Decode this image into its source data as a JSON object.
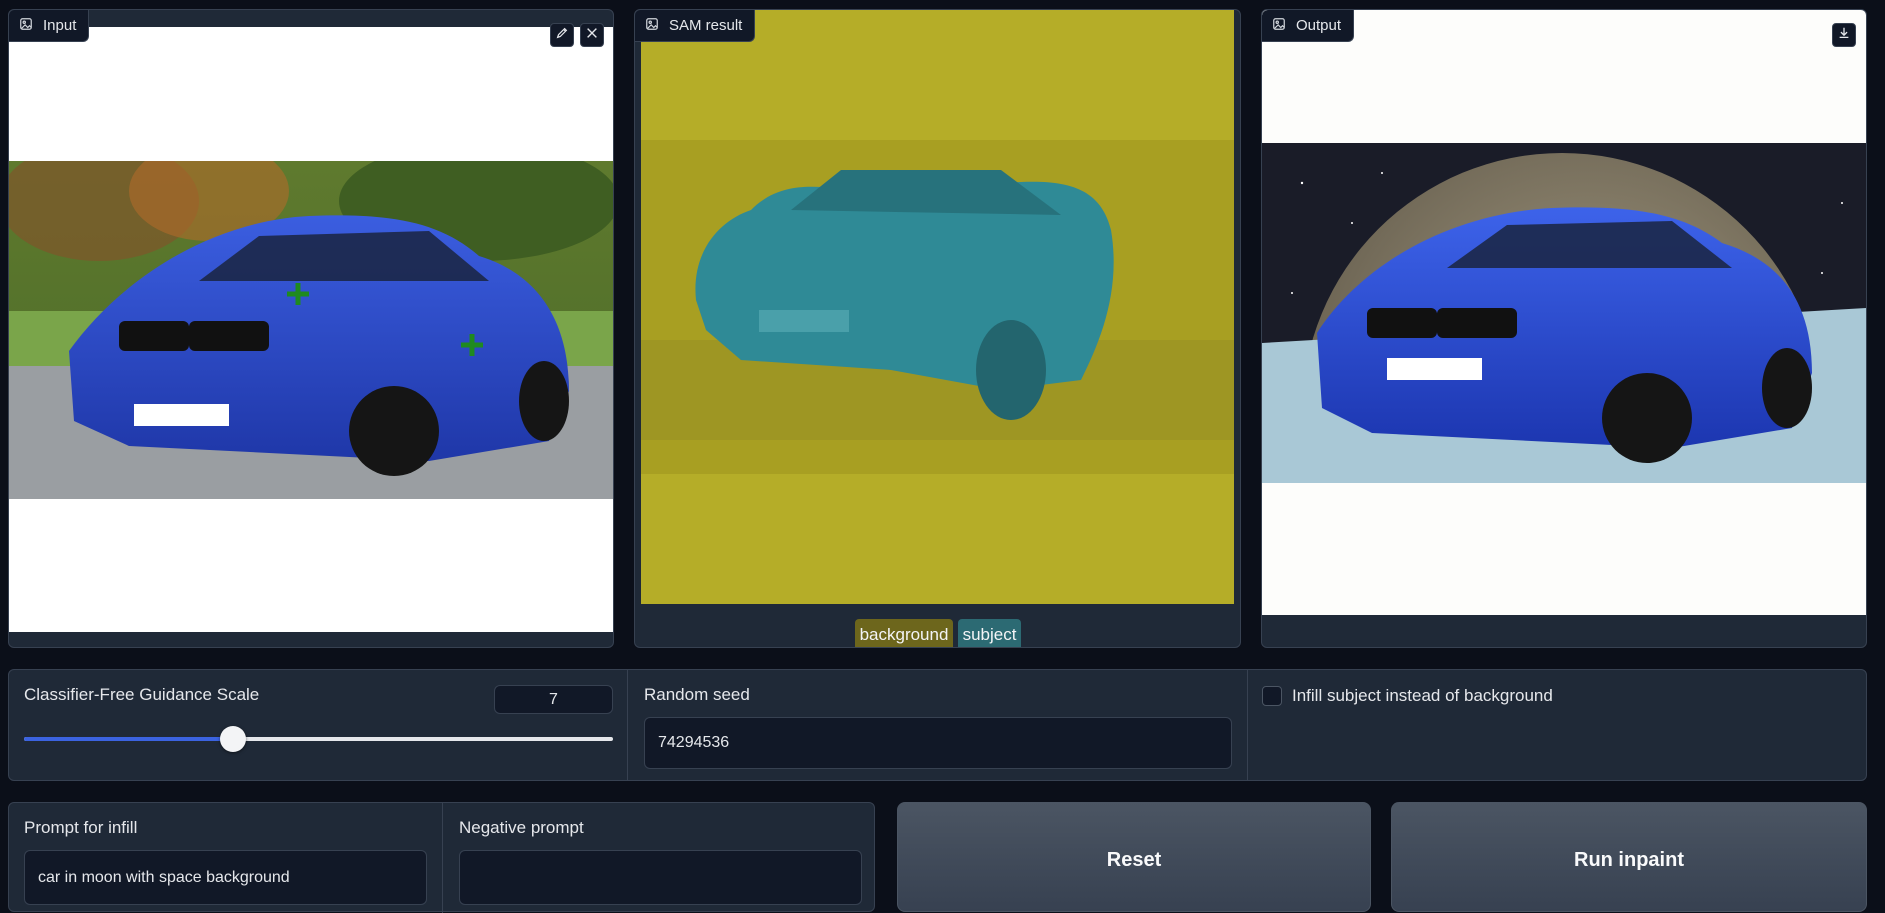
{
  "panels": {
    "input": {
      "label": "Input",
      "points": [
        "green-plus",
        "green-plus"
      ]
    },
    "sam": {
      "label": "SAM result"
    },
    "output": {
      "label": "Output"
    }
  },
  "legend": {
    "background": "background",
    "subject": "subject"
  },
  "cfg": {
    "label": "Classifier-Free Guidance Scale",
    "value": "7",
    "fraction": 0.355
  },
  "seed": {
    "label": "Random seed",
    "value": "74294536"
  },
  "infill_subject": {
    "label": "Infill subject instead of background",
    "checked": false
  },
  "prompt": {
    "label": "Prompt for infill",
    "value": "car in moon with space background"
  },
  "negative_prompt": {
    "label": "Negative prompt",
    "value": ""
  },
  "buttons": {
    "reset": "Reset",
    "run": "Run inpaint"
  },
  "colors": {
    "app_bg": "#0b0f19",
    "panel_bg": "#1f2937",
    "slider_accent": "#3b63e0",
    "mask_background": "#b5ad28",
    "mask_subject": "#2f8a96",
    "point_marker": "#1f8a1f"
  }
}
